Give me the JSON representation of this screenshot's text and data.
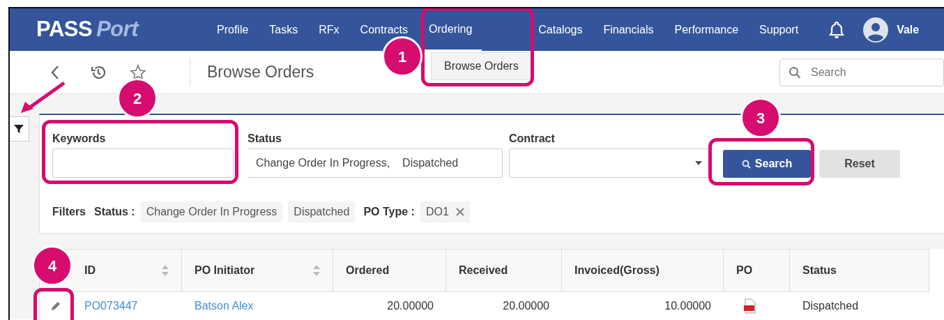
{
  "nav": {
    "logo": {
      "first": "PASS",
      "second": "Port"
    },
    "items": [
      {
        "label": "Profile",
        "selected": false
      },
      {
        "label": "Tasks",
        "selected": false
      },
      {
        "label": "RFx",
        "selected": false
      },
      {
        "label": "Contracts",
        "selected": false
      },
      {
        "label": "Ordering",
        "selected": true
      },
      {
        "label": "Catalogs",
        "selected": false
      },
      {
        "label": "Financials",
        "selected": false
      },
      {
        "label": "Performance",
        "selected": false
      },
      {
        "label": "Support",
        "selected": false
      }
    ],
    "user": "Vale"
  },
  "dropdown": {
    "items": [
      "Browse Orders"
    ]
  },
  "page": {
    "title": "Browse Orders",
    "search": {
      "placeholder": "Search"
    }
  },
  "filters": {
    "fields": [
      {
        "kind": "text",
        "label": "Keywords"
      },
      {
        "kind": "multiselect",
        "label": "Status",
        "values": [
          "Change Order In Progress,",
          "Dispatched"
        ]
      },
      {
        "kind": "select",
        "label": "Contract"
      }
    ],
    "buttons": [
      {
        "kind": "primary",
        "label": "Search"
      },
      {
        "kind": "secondary",
        "label": "Reset"
      }
    ],
    "applied": {
      "label": "Filters",
      "groups": [
        {
          "name": "Status :",
          "tags": [
            "Change Order In Progress",
            "Dispatched"
          ],
          "removable": false
        },
        {
          "name": "PO Type :",
          "tags": [
            "DO1"
          ],
          "removable": true
        }
      ]
    }
  },
  "table": {
    "columns": [
      {
        "label": "ID",
        "sortable": true,
        "kind": "link"
      },
      {
        "label": "PO Initiator",
        "sortable": true,
        "kind": "link"
      },
      {
        "label": "Ordered",
        "sortable": false,
        "kind": "number"
      },
      {
        "label": "Received",
        "sortable": false,
        "kind": "number"
      },
      {
        "label": "Invoiced(Gross)",
        "sortable": false,
        "kind": "number"
      },
      {
        "label": "PO",
        "sortable": false,
        "kind": "pdf"
      },
      {
        "label": "Status",
        "sortable": false,
        "kind": "text"
      }
    ],
    "rows": [
      {
        "cells": [
          "PO073447",
          "Batson Alex",
          "20.00000",
          "20.00000",
          "10.00000",
          "",
          "Dispatched"
        ]
      }
    ]
  },
  "callouts": [
    {
      "number": "1"
    },
    {
      "number": "2"
    },
    {
      "number": "3"
    },
    {
      "number": "4"
    }
  ]
}
